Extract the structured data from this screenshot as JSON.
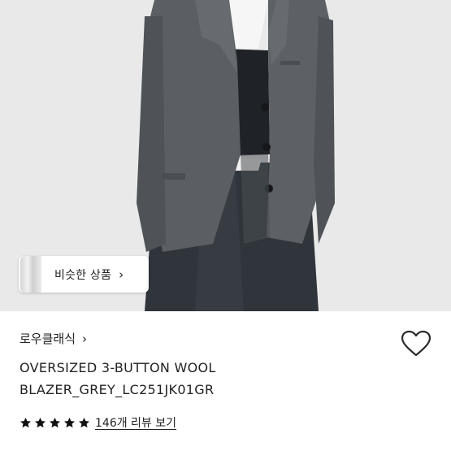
{
  "similar_products": {
    "label": "비슷한 상품"
  },
  "product": {
    "brand": "로우클래식",
    "title_line1": "OVERSIZED 3-BUTTON WOOL",
    "title_line2": "BLAZER_GREY_LC251JK01GR",
    "rating_stars": 5,
    "review_link": "146개 리뷰 보기"
  },
  "icons": {
    "brand": "chevron-right-icon",
    "wishlist": "heart-outline-icon",
    "star": "star-filled-icon"
  },
  "colors": {
    "blazer": "#5b5f63",
    "jeans": "#2f353b",
    "background": "#e9e9ea",
    "text": "#222222"
  }
}
